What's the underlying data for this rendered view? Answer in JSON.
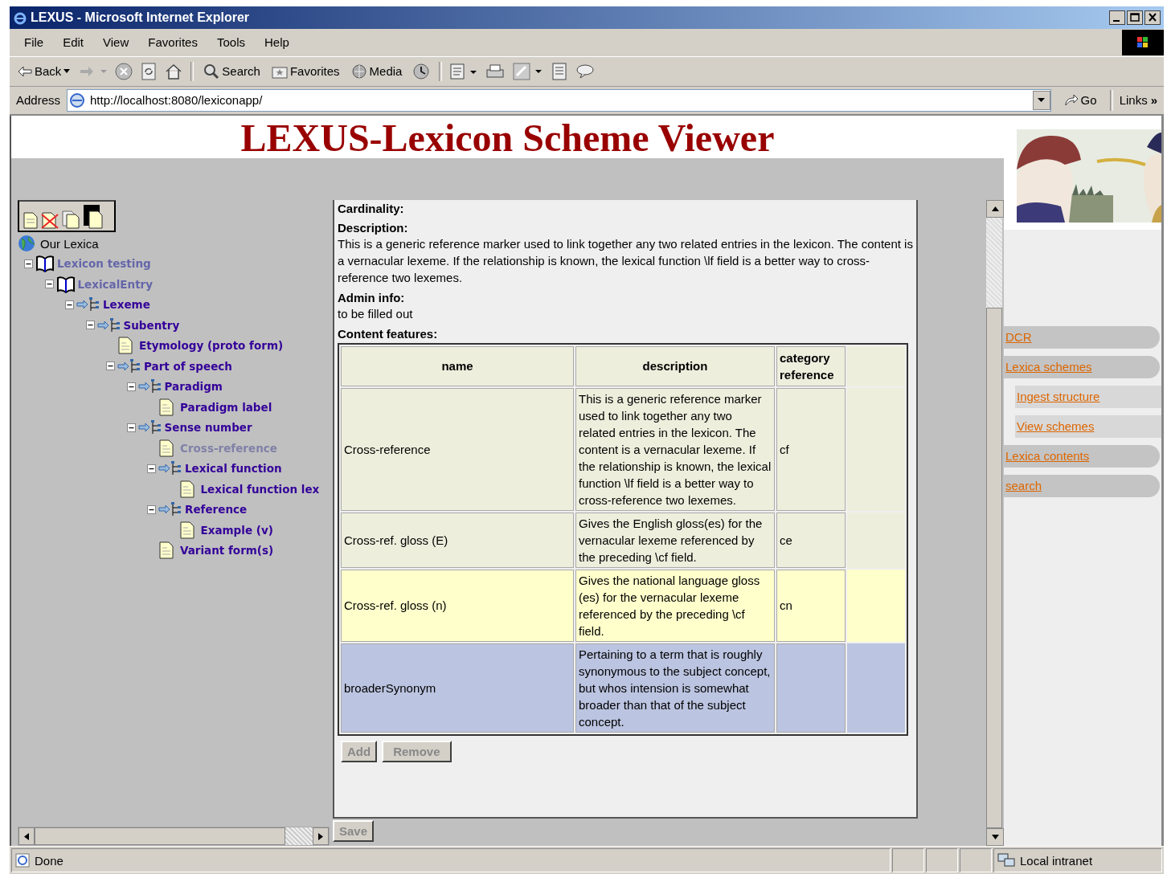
{
  "window": {
    "title": "LEXUS - Microsoft Internet Explorer"
  },
  "menu": [
    "File",
    "Edit",
    "View",
    "Favorites",
    "Tools",
    "Help"
  ],
  "toolbar": {
    "back": "Back",
    "search": "Search",
    "favorites": "Favorites",
    "media": "Media"
  },
  "address": {
    "label": "Address",
    "value": "http://localhost:8080/lexiconapp/",
    "go": "Go",
    "links": "Links",
    "more": "»"
  },
  "page": {
    "heading": "LEXUS-Lexicon Scheme Viewer",
    "tree": {
      "root": "Our Lexica",
      "items": [
        {
          "label": "Lexicon testing",
          "kind": "lexicon",
          "selected": false,
          "expanded": true,
          "children": [
            {
              "label": "LexicalEntry",
              "kind": "lexicon",
              "selected": false,
              "expanded": true,
              "children": [
                {
                  "label": "Lexeme",
                  "kind": "group",
                  "selected": false,
                  "expanded": true,
                  "children": [
                    {
                      "label": "Subentry",
                      "kind": "group",
                      "selected": false,
                      "expanded": true,
                      "children": [
                        {
                          "label": "Etymology (proto form)",
                          "kind": "field",
                          "selected": false
                        },
                        {
                          "label": "Part of speech",
                          "kind": "group",
                          "selected": false,
                          "expanded": true,
                          "children": [
                            {
                              "label": "Paradigm",
                              "kind": "group",
                              "selected": false,
                              "expanded": true,
                              "children": [
                                {
                                  "label": "Paradigm label",
                                  "kind": "field",
                                  "selected": false
                                }
                              ]
                            },
                            {
                              "label": "Sense number",
                              "kind": "group",
                              "selected": false,
                              "expanded": true,
                              "children": [
                                {
                                  "label": "Cross-reference",
                                  "kind": "field",
                                  "selected": true
                                },
                                {
                                  "label": "Lexical function",
                                  "kind": "group",
                                  "selected": false,
                                  "expanded": true,
                                  "children": [
                                    {
                                      "label": "Lexical function lex",
                                      "kind": "field",
                                      "selected": false
                                    }
                                  ]
                                },
                                {
                                  "label": "Reference",
                                  "kind": "group",
                                  "selected": false,
                                  "expanded": true,
                                  "children": [
                                    {
                                      "label": "Example (v)",
                                      "kind": "field",
                                      "selected": false
                                    }
                                  ]
                                },
                                {
                                  "label": "Variant form(s)",
                                  "kind": "field",
                                  "selected": false
                                }
                              ]
                            }
                          ]
                        }
                      ]
                    }
                  ]
                }
              ]
            }
          ]
        }
      ]
    },
    "details": {
      "cardinality_label": "Cardinality:",
      "description_label": "Description:",
      "description": "This is a generic reference marker used to link together any two related entries in the lexicon. The content is a vernacular lexeme. If the relationship is known, the lexical function \\lf field is a better way to cross-reference two lexemes.",
      "admin_label": "Admin info:",
      "admin": "to be filled out",
      "features_label": "Content features:",
      "columns": [
        "name",
        "description",
        "category reference"
      ],
      "rows": [
        {
          "name": "Cross-reference",
          "description": "This is a generic reference marker used to link together any two related entries in the lexicon. The content is a vernacular lexeme. If the relationship is known, the lexical function \\lf field is a better way to cross-reference two lexemes.",
          "category": "cf",
          "hovered": false,
          "selected": false
        },
        {
          "name": "Cross-ref. gloss (E)",
          "description": "Gives the English gloss(es) for the vernacular lexeme referenced by the preceding \\cf field.",
          "category": "ce",
          "hovered": false,
          "selected": false
        },
        {
          "name": "Cross-ref. gloss (n)",
          "description": "Gives the national language gloss (es) for the vernacular lexeme referenced by the preceding \\cf field.",
          "category": "cn",
          "hovered": true,
          "selected": false
        },
        {
          "name": "broaderSynonym",
          "description": "Pertaining to a term that is roughly synonymous to the subject concept, but whos intension is somewhat broader than that of the subject concept.",
          "hovered": false,
          "selected": true
        }
      ],
      "add": "Add",
      "remove": "Remove",
      "save": "Save"
    },
    "nav": [
      {
        "label": "DCR",
        "sub": false
      },
      {
        "label": "Lexica schemes",
        "sub": false
      },
      {
        "label": "Ingest structure",
        "sub": true
      },
      {
        "label": "View schemes",
        "sub": true
      },
      {
        "label": "Lexica contents",
        "sub": false
      },
      {
        "label": "search",
        "sub": false
      }
    ]
  },
  "status_bar": {
    "text": "Done",
    "zone": "Local intranet"
  }
}
